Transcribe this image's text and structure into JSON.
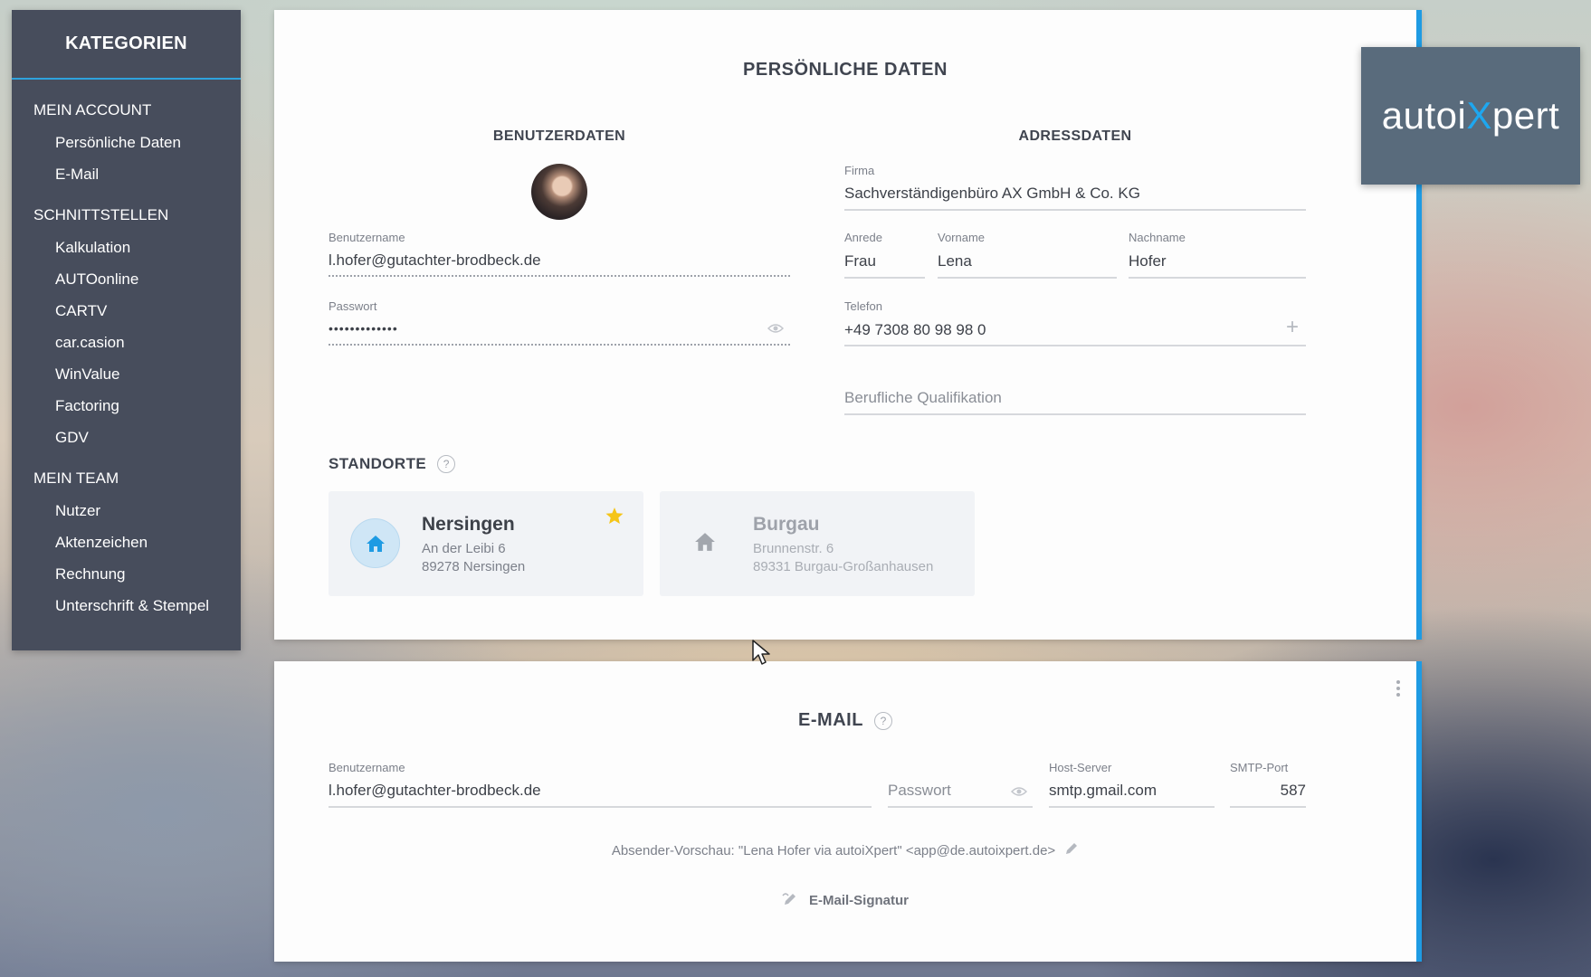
{
  "sidebar": {
    "title": "KATEGORIEN",
    "sections": [
      {
        "label": "MEIN ACCOUNT",
        "items": [
          "Persönliche Daten",
          "E-Mail"
        ]
      },
      {
        "label": "SCHNITTSTELLEN",
        "items": [
          "Kalkulation",
          "AUTOonline",
          "CARTV",
          "car.casion",
          "WinValue",
          "Factoring",
          "GDV"
        ]
      },
      {
        "label": "MEIN TEAM",
        "items": [
          "Nutzer",
          "Aktenzeichen",
          "Rechnung",
          "Unterschrift & Stempel"
        ]
      }
    ]
  },
  "personal": {
    "title": "PERSÖNLICHE DATEN",
    "user_heading": "BENUTZERDATEN",
    "address_heading": "ADRESSDATEN",
    "username_label": "Benutzername",
    "username_value": "l.hofer@gutachter-brodbeck.de",
    "password_label": "Passwort",
    "password_value": "•••••••••••••",
    "firm_label": "Firma",
    "firm_value": "Sachverständigenbüro AX GmbH & Co. KG",
    "salutation_label": "Anrede",
    "salutation_value": "Frau",
    "firstname_label": "Vorname",
    "firstname_value": "Lena",
    "lastname_label": "Nachname",
    "lastname_value": "Hofer",
    "phone_label": "Telefon",
    "phone_value": "+49 7308 80 98 98 0",
    "qualification_placeholder": "Berufliche Qualifikation"
  },
  "locations": {
    "heading": "STANDORTE",
    "help": "?",
    "items": [
      {
        "name": "Nersingen",
        "street": "An der Leibi 6",
        "city": "89278 Nersingen",
        "primary": true
      },
      {
        "name": "Burgau",
        "street": "Brunnenstr. 6",
        "city": "89331 Burgau-Großanhausen",
        "primary": false
      }
    ]
  },
  "email": {
    "title": "E-MAIL",
    "help": "?",
    "username_label": "Benutzername",
    "username_value": "l.hofer@gutachter-brodbeck.de",
    "password_placeholder": "Passwort",
    "host_label": "Host-Server",
    "host_value": "smtp.gmail.com",
    "port_label": "SMTP-Port",
    "port_value": "587",
    "sender_preview": "Absender-Vorschau: \"Lena Hofer via autoiXpert\" <app@de.autoixpert.de>",
    "signature_label": "E-Mail-Signatur"
  },
  "logo": {
    "text_a": "autoi",
    "text_x": "X",
    "text_b": "pert"
  },
  "colors": {
    "accent": "#1e9be3",
    "sidebar_bg": "#474d5c",
    "star": "#f5c518"
  }
}
